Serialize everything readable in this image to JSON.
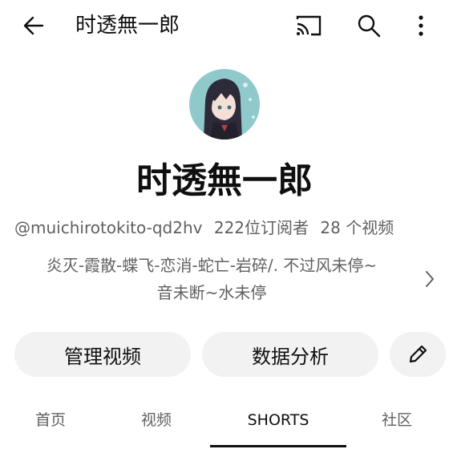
{
  "header": {
    "title": "时透無一郎",
    "icons": {
      "back": "arrow-left-icon",
      "cast": "cast-icon",
      "search": "search-icon",
      "more": "more-vertical-icon"
    }
  },
  "channel": {
    "avatar": "avatar",
    "name": "时透無一郎",
    "handle": "@muichirotokito-qd2hv",
    "subscribers": "222位订阅者",
    "videos": "28 个视频",
    "description_line1": "炎灭-霞散-蝶飞-恋消-蛇亡-岩碎/. 不过风未停~",
    "description_line2": "音未断~水未停"
  },
  "actions": {
    "manage_videos": "管理视频",
    "analytics": "数据分析",
    "edit_icon": "pencil-icon"
  },
  "tabs": [
    {
      "label": "首页"
    },
    {
      "label": "视频"
    },
    {
      "label": "SHORTS"
    },
    {
      "label": "社区"
    }
  ],
  "active_tab": "SHORTS",
  "colors": {
    "text": "#0f0f0f",
    "secondary": "#606060",
    "pill": "#f2f2f2"
  }
}
